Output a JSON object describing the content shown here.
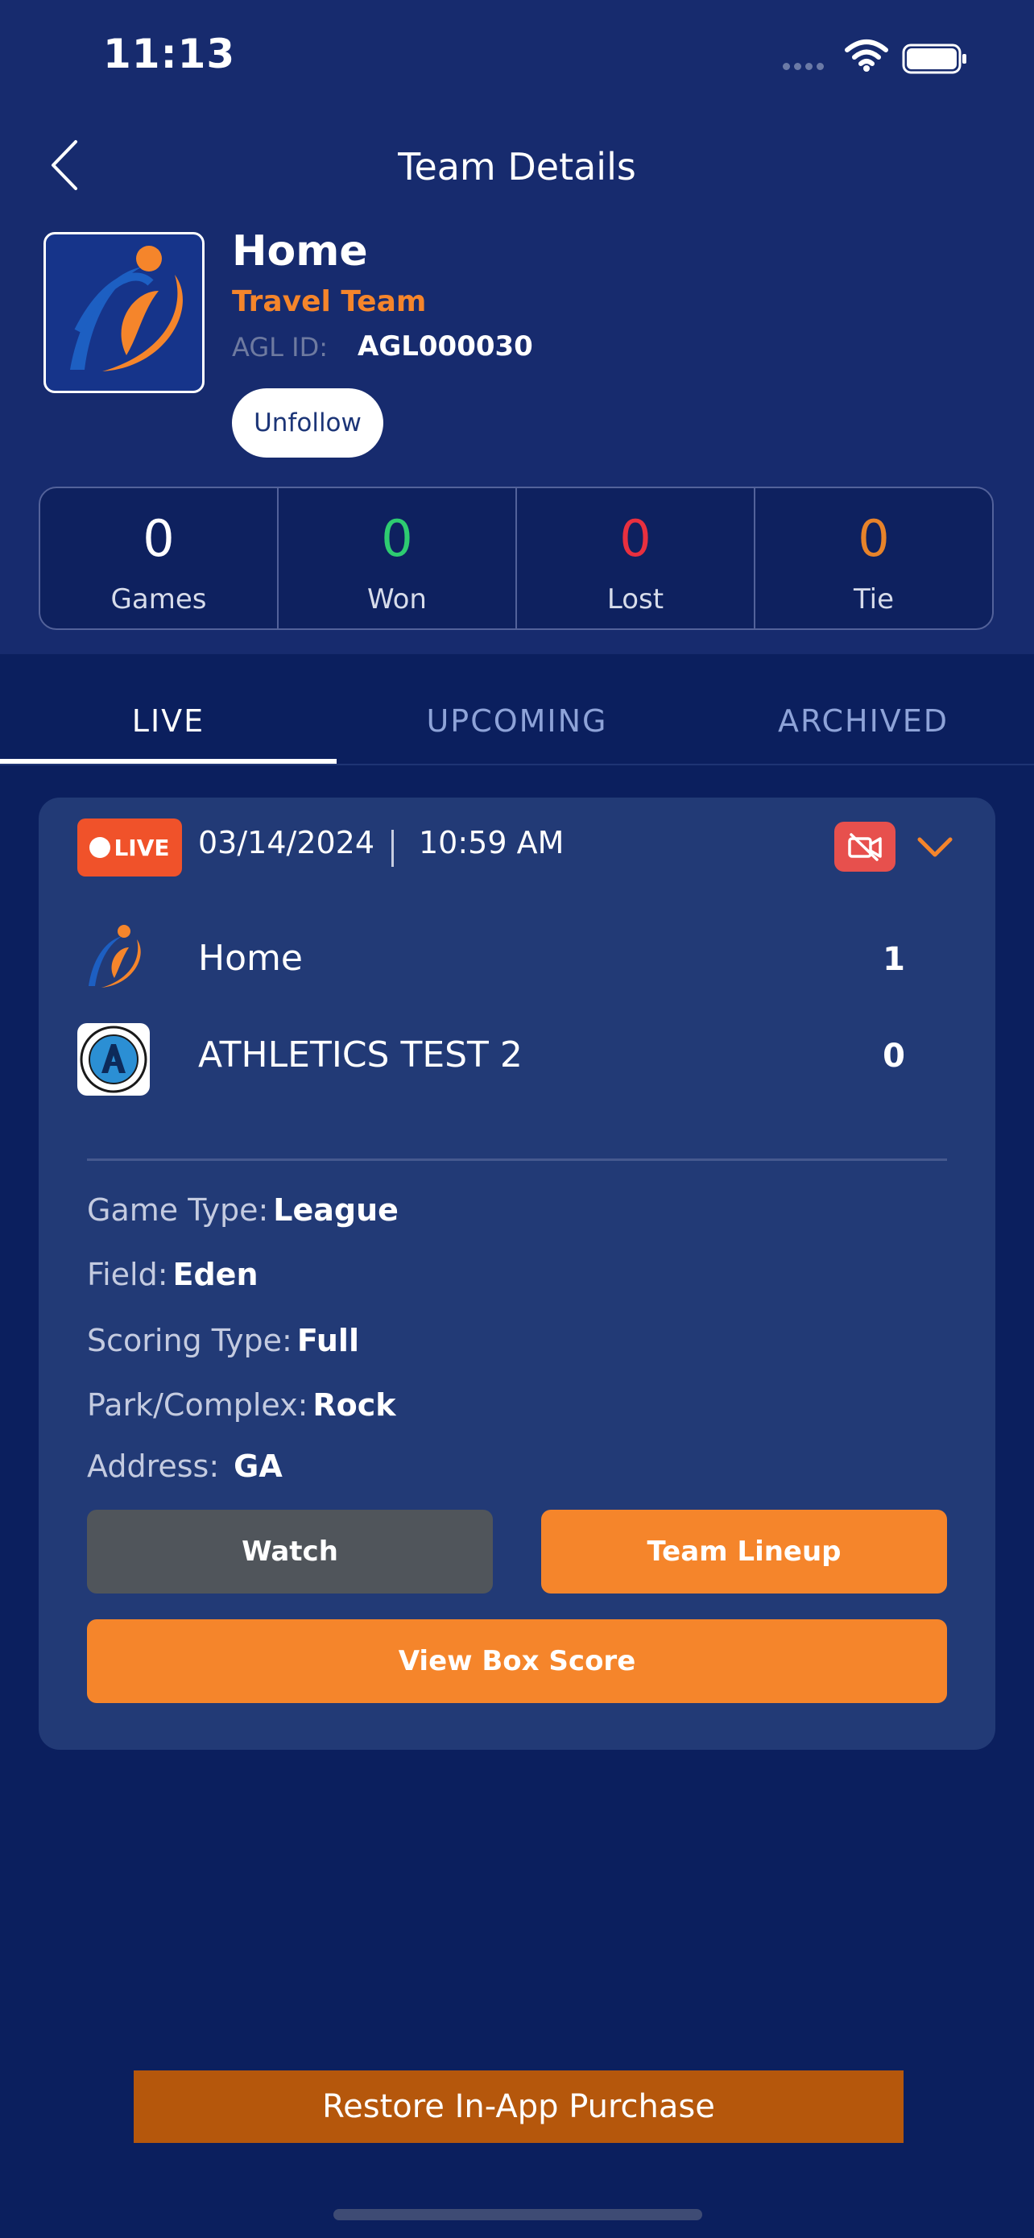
{
  "status_bar": {
    "time": "11:13"
  },
  "header": {
    "title": "Team Details"
  },
  "team": {
    "name": "Home",
    "type": "Travel Team",
    "agl_label": "AGL ID:",
    "agl_id": "AGL000030",
    "follow_button": "Unfollow"
  },
  "stats": [
    {
      "value": "0",
      "label": "Games",
      "color": "#ffffff"
    },
    {
      "value": "0",
      "label": "Won",
      "color": "#2ecc71"
    },
    {
      "value": "0",
      "label": "Lost",
      "color": "#e8303f"
    },
    {
      "value": "0",
      "label": "Tie",
      "color": "#e7832a"
    }
  ],
  "tabs": {
    "live": "LIVE",
    "upcoming": "UPCOMING",
    "archived": "ARCHIVED",
    "active": "LIVE"
  },
  "game": {
    "live_badge": "LIVE",
    "date": "03/14/2024",
    "time": "10:59 AM",
    "teams": [
      {
        "name": "Home",
        "score": "1"
      },
      {
        "name": "ATHLETICS TEST 2",
        "score": "0"
      }
    ],
    "details": {
      "game_type_label": "Game Type:",
      "game_type": "League",
      "field_label": "Field:",
      "field": "Eden",
      "scoring_type_label": "Scoring Type:",
      "scoring_type": "Full",
      "park_label": "Park/Complex:",
      "park": "Rock",
      "address_label": "Address:",
      "address": "GA"
    },
    "buttons": {
      "watch": "Watch",
      "lineup": "Team Lineup",
      "box_score": "View Box Score"
    }
  },
  "footer": {
    "restore": "Restore In-App Purchase"
  },
  "colors": {
    "background": "#0b1f5e",
    "header": "#172b6e",
    "card": "#223a76",
    "accent": "#f5852b",
    "live": "#f0522a"
  }
}
